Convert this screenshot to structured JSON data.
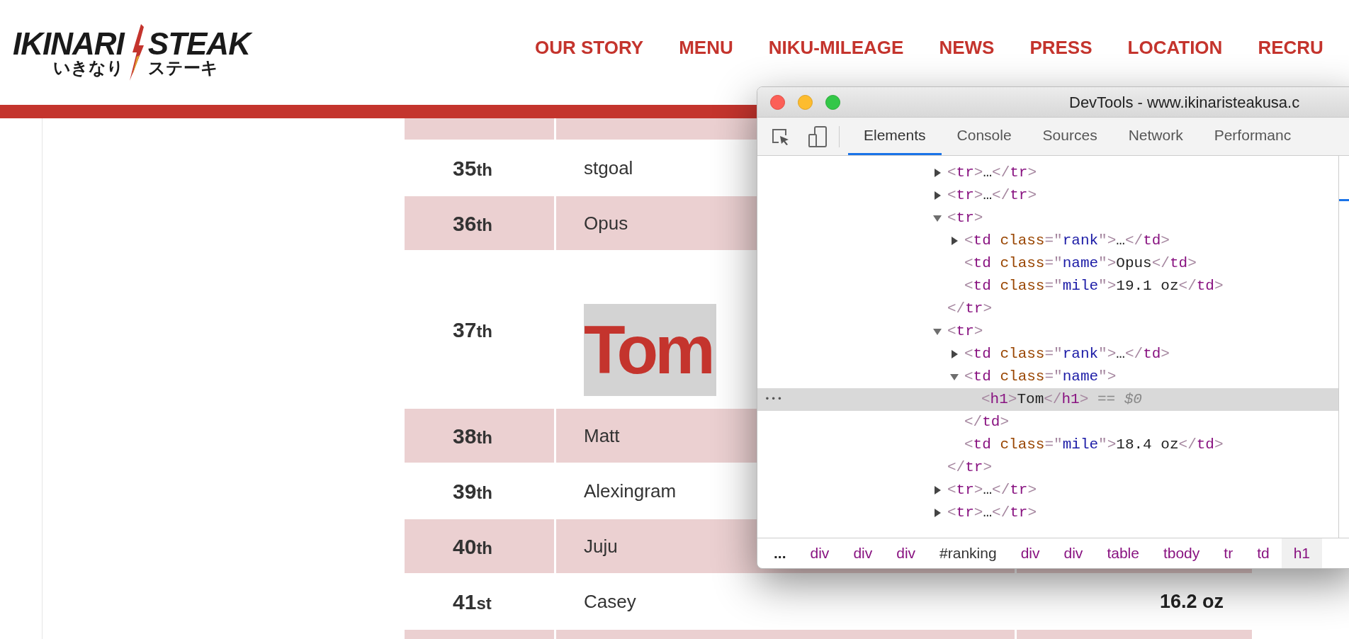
{
  "logo": {
    "top_left": "IKINARI",
    "top_right": "STEAK",
    "bottom_left": "いきなり",
    "bottom_right": "ステーキ"
  },
  "nav": [
    "OUR STORY",
    "MENU",
    "NIKU-MILEAGE",
    "NEWS",
    "PRESS",
    "LOCATION",
    "RECRU"
  ],
  "ranking": [
    {
      "rank": "35",
      "suffix": "th",
      "name": "stgoal",
      "kind": "plain"
    },
    {
      "rank": "36",
      "suffix": "th",
      "name": "Opus",
      "kind": "plain"
    },
    {
      "rank": "37",
      "suffix": "th",
      "name": "Tom",
      "kind": "heading"
    },
    {
      "rank": "38",
      "suffix": "th",
      "name": "Matt",
      "kind": "plain"
    },
    {
      "rank": "39",
      "suffix": "th",
      "name": "Alexingram",
      "kind": "plain"
    },
    {
      "rank": "40",
      "suffix": "th",
      "name": "Juju",
      "kind": "plain"
    },
    {
      "rank": "41",
      "suffix": "st",
      "name": "Casey",
      "kind": "plain",
      "mile": "16.2 oz"
    }
  ],
  "devtools": {
    "title": "DevTools - www.ikinaristeakusa.c",
    "tabs": [
      {
        "label": "Elements",
        "selected": true
      },
      {
        "label": "Console",
        "selected": false
      },
      {
        "label": "Sources",
        "selected": false
      },
      {
        "label": "Network",
        "selected": false
      },
      {
        "label": "Performanc",
        "selected": false
      }
    ],
    "tree": [
      {
        "open": [
          {
            "kind": "punct",
            "text": "<"
          },
          {
            "kind": "tag",
            "text": "tr"
          },
          {
            "kind": "punct",
            "text": ">"
          }
        ],
        "text": "…",
        "close": [
          {
            "kind": "punct",
            "text": "</"
          },
          {
            "kind": "tag",
            "text": "tr"
          },
          {
            "kind": "punct",
            "text": ">"
          }
        ],
        "expanded": false,
        "selected": false
      },
      {
        "open": [
          {
            "kind": "punct",
            "text": "<"
          },
          {
            "kind": "tag",
            "text": "tr"
          },
          {
            "kind": "punct",
            "text": ">"
          }
        ],
        "text": "…",
        "close": [
          {
            "kind": "punct",
            "text": "</"
          },
          {
            "kind": "tag",
            "text": "tr"
          },
          {
            "kind": "punct",
            "text": ">"
          }
        ],
        "expanded": false,
        "selected": false
      },
      {
        "open": [
          {
            "kind": "punct",
            "text": "<"
          },
          {
            "kind": "tag",
            "text": "tr"
          },
          {
            "kind": "punct",
            "text": ">"
          }
        ],
        "close": [
          {
            "kind": "punct",
            "text": "</"
          },
          {
            "kind": "tag",
            "text": "tr"
          },
          {
            "kind": "punct",
            "text": ">"
          }
        ],
        "expanded": true,
        "selected": false,
        "children": [
          {
            "open": [
              {
                "kind": "punct",
                "text": "<"
              },
              {
                "kind": "tag",
                "text": "td"
              },
              {
                "kind": "attr",
                "text": " class"
              },
              {
                "kind": "punct",
                "text": "=\""
              },
              {
                "kind": "value",
                "text": "rank"
              },
              {
                "kind": "punct",
                "text": "\">"
              }
            ],
            "text": "…",
            "close": [
              {
                "kind": "punct",
                "text": "</"
              },
              {
                "kind": "tag",
                "text": "td"
              },
              {
                "kind": "punct",
                "text": ">"
              }
            ],
            "expanded": false,
            "selected": false
          },
          {
            "open": [
              {
                "kind": "punct",
                "text": "<"
              },
              {
                "kind": "tag",
                "text": "td"
              },
              {
                "kind": "attr",
                "text": " class"
              },
              {
                "kind": "punct",
                "text": "=\""
              },
              {
                "kind": "value",
                "text": "name"
              },
              {
                "kind": "punct",
                "text": "\">"
              }
            ],
            "text": "Opus",
            "close": [
              {
                "kind": "punct",
                "text": "</"
              },
              {
                "kind": "tag",
                "text": "td"
              },
              {
                "kind": "punct",
                "text": ">"
              }
            ],
            "selected": false
          },
          {
            "open": [
              {
                "kind": "punct",
                "text": "<"
              },
              {
                "kind": "tag",
                "text": "td"
              },
              {
                "kind": "attr",
                "text": " class"
              },
              {
                "kind": "punct",
                "text": "=\""
              },
              {
                "kind": "value",
                "text": "mile"
              },
              {
                "kind": "punct",
                "text": "\">"
              }
            ],
            "text": "19.1 oz",
            "close": [
              {
                "kind": "punct",
                "text": "</"
              },
              {
                "kind": "tag",
                "text": "td"
              },
              {
                "kind": "punct",
                "text": ">"
              }
            ],
            "selected": false
          }
        ]
      },
      {
        "open": [
          {
            "kind": "punct",
            "text": "<"
          },
          {
            "kind": "tag",
            "text": "tr"
          },
          {
            "kind": "punct",
            "text": ">"
          }
        ],
        "close": [
          {
            "kind": "punct",
            "text": "</"
          },
          {
            "kind": "tag",
            "text": "tr"
          },
          {
            "kind": "punct",
            "text": ">"
          }
        ],
        "expanded": true,
        "selected": false,
        "children": [
          {
            "open": [
              {
                "kind": "punct",
                "text": "<"
              },
              {
                "kind": "tag",
                "text": "td"
              },
              {
                "kind": "attr",
                "text": " class"
              },
              {
                "kind": "punct",
                "text": "=\""
              },
              {
                "kind": "value",
                "text": "rank"
              },
              {
                "kind": "punct",
                "text": "\">"
              }
            ],
            "text": "…",
            "close": [
              {
                "kind": "punct",
                "text": "</"
              },
              {
                "kind": "tag",
                "text": "td"
              },
              {
                "kind": "punct",
                "text": ">"
              }
            ],
            "expanded": false,
            "selected": false
          },
          {
            "open": [
              {
                "kind": "punct",
                "text": "<"
              },
              {
                "kind": "tag",
                "text": "td"
              },
              {
                "kind": "attr",
                "text": " class"
              },
              {
                "kind": "punct",
                "text": "=\""
              },
              {
                "kind": "value",
                "text": "name"
              },
              {
                "kind": "punct",
                "text": "\">"
              }
            ],
            "close": [
              {
                "kind": "punct",
                "text": "</"
              },
              {
                "kind": "tag",
                "text": "td"
              },
              {
                "kind": "punct",
                "text": ">"
              }
            ],
            "expanded": true,
            "selected": false,
            "children": [
              {
                "open": [
                  {
                    "kind": "punct",
                    "text": "<"
                  },
                  {
                    "kind": "tag",
                    "text": "h1"
                  },
                  {
                    "kind": "punct",
                    "text": ">"
                  }
                ],
                "text": "Tom",
                "close": [
                  {
                    "kind": "punct",
                    "text": "</"
                  },
                  {
                    "kind": "tag",
                    "text": "h1"
                  },
                  {
                    "kind": "punct",
                    "text": ">"
                  }
                ],
                "selected": true,
                "marker": "== *$0*"
              }
            ]
          },
          {
            "open": [
              {
                "kind": "punct",
                "text": "<"
              },
              {
                "kind": "tag",
                "text": "td"
              },
              {
                "kind": "attr",
                "text": " class"
              },
              {
                "kind": "punct",
                "text": "=\""
              },
              {
                "kind": "value",
                "text": "mile"
              },
              {
                "kind": "punct",
                "text": "\">"
              }
            ],
            "text": "18.4 oz",
            "close": [
              {
                "kind": "punct",
                "text": "</"
              },
              {
                "kind": "tag",
                "text": "td"
              },
              {
                "kind": "punct",
                "text": ">"
              }
            ],
            "selected": false
          }
        ]
      },
      {
        "open": [
          {
            "kind": "punct",
            "text": "<"
          },
          {
            "kind": "tag",
            "text": "tr"
          },
          {
            "kind": "punct",
            "text": ">"
          }
        ],
        "text": "…",
        "close": [
          {
            "kind": "punct",
            "text": "</"
          },
          {
            "kind": "tag",
            "text": "tr"
          },
          {
            "kind": "punct",
            "text": ">"
          }
        ],
        "expanded": false,
        "selected": false
      },
      {
        "open": [
          {
            "kind": "punct",
            "text": "<"
          },
          {
            "kind": "tag",
            "text": "tr"
          },
          {
            "kind": "punct",
            "text": ">"
          }
        ],
        "text": "…",
        "close": [
          {
            "kind": "punct",
            "text": "</"
          },
          {
            "kind": "tag",
            "text": "tr"
          },
          {
            "kind": "punct",
            "text": ">"
          }
        ],
        "expanded": false,
        "selected": false
      }
    ],
    "more_marker": "•••",
    "breadcrumbs": [
      {
        "label": "...",
        "kind": "more",
        "selected": false
      },
      {
        "label": "div",
        "kind": "tag",
        "selected": false
      },
      {
        "label": "div",
        "kind": "tag",
        "selected": false
      },
      {
        "label": "div",
        "kind": "tag",
        "selected": false
      },
      {
        "label": "#ranking",
        "kind": "id",
        "selected": false
      },
      {
        "label": "div",
        "kind": "tag",
        "selected": false
      },
      {
        "label": "div",
        "kind": "tag",
        "selected": false
      },
      {
        "label": "table",
        "kind": "tag",
        "selected": false
      },
      {
        "label": "tbody",
        "kind": "tag",
        "selected": false
      },
      {
        "label": "tr",
        "kind": "tag",
        "selected": false
      },
      {
        "label": "td",
        "kind": "tag",
        "selected": false
      },
      {
        "label": "h1",
        "kind": "tag",
        "selected": true
      }
    ]
  }
}
